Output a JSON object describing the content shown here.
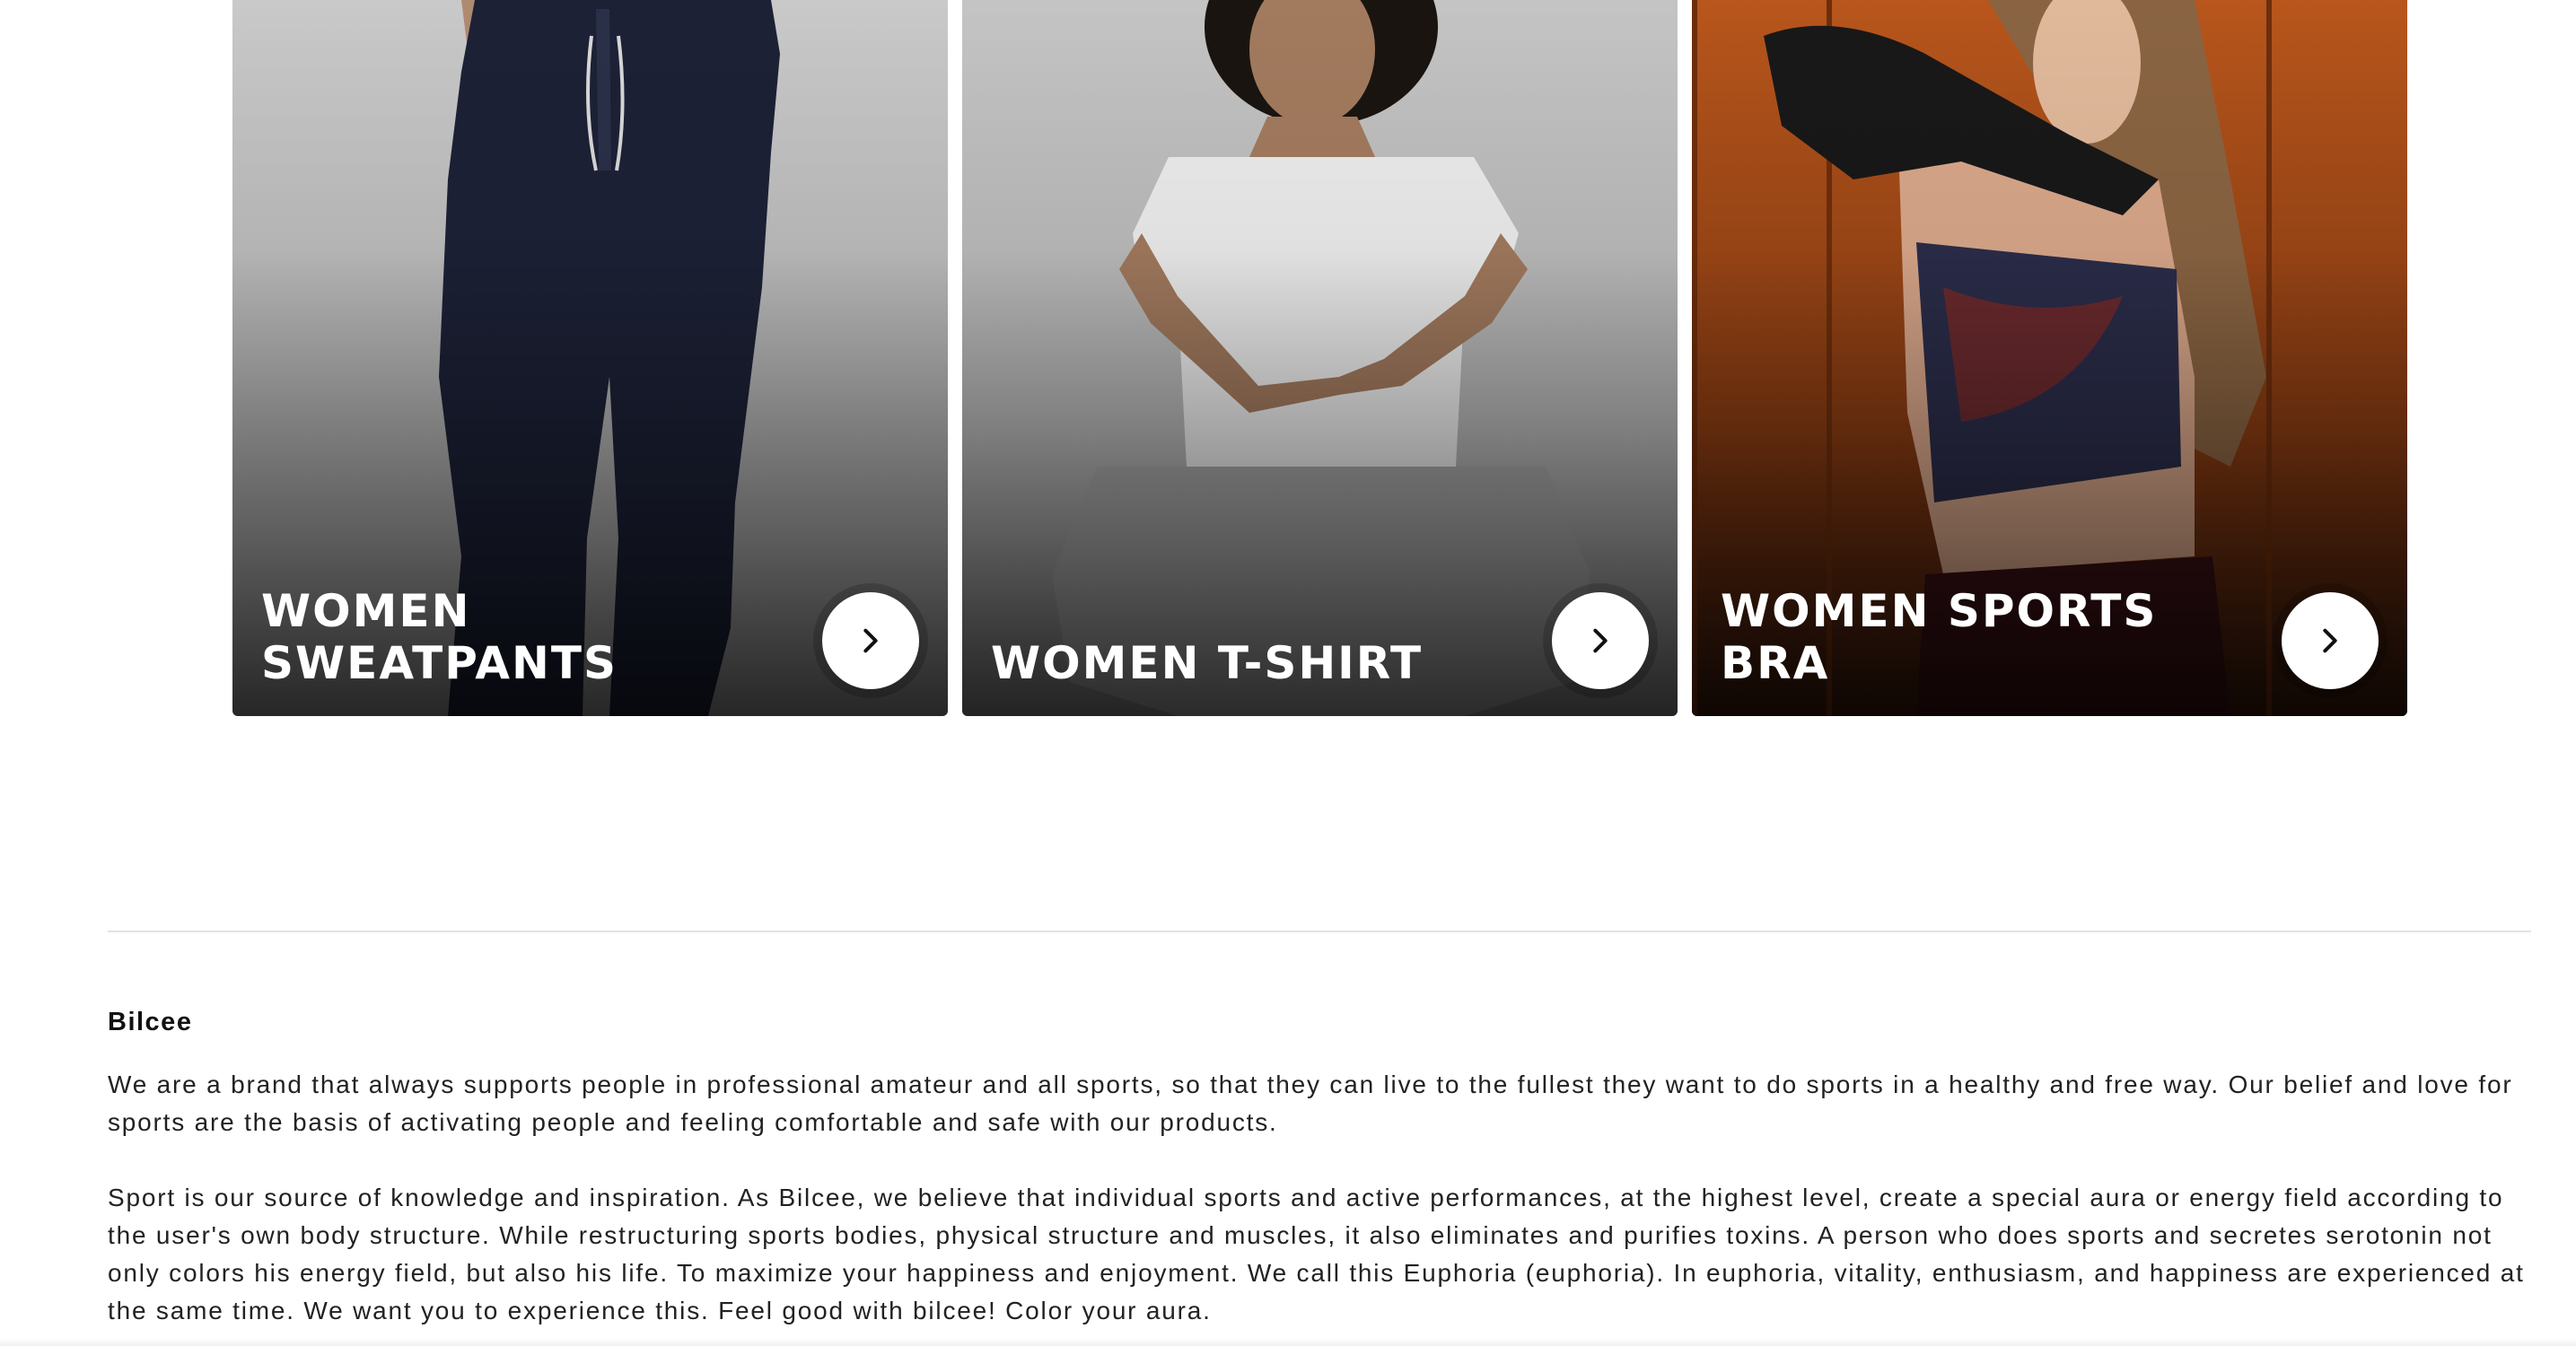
{
  "categories": [
    {
      "title": "WOMEN SWEATPANTS",
      "arrow_icon": "chevron-right-icon"
    },
    {
      "title": "WOMEN T-SHIRT",
      "arrow_icon": "chevron-right-icon"
    },
    {
      "title": "WOMEN SPORTS BRA",
      "arrow_icon": "chevron-right-icon"
    }
  ],
  "about": {
    "title": "Bilcee",
    "paragraphs": [
      "We are a brand that always supports people in professional amateur and all sports, so that they can live to the fullest they want to do sports in a healthy and free way. Our belief and love for sports are the basis of activating people and feeling comfortable and safe with our products.",
      "Sport is our source of knowledge and inspiration. As Bilcee, we believe that individual sports and active performances, at the highest level, create a special aura or energy field according to the user's own body structure. While restructuring sports bodies, physical structure and muscles, it also eliminates and purifies toxins. A person who does sports and secretes serotonin not only colors his energy field, but also his life. To maximize your happiness and enjoyment. We call this Euphoria (euphoria). In euphoria, vitality, enthusiasm, and happiness are experienced at the same time. We want you to experience this. Feel good with bilcee! Color your aura."
    ]
  },
  "colors": {
    "card_text": "#ffffff",
    "arrow_button_bg": "#ffffff",
    "divider": "#e3e3e3",
    "body_text": "#222222"
  }
}
